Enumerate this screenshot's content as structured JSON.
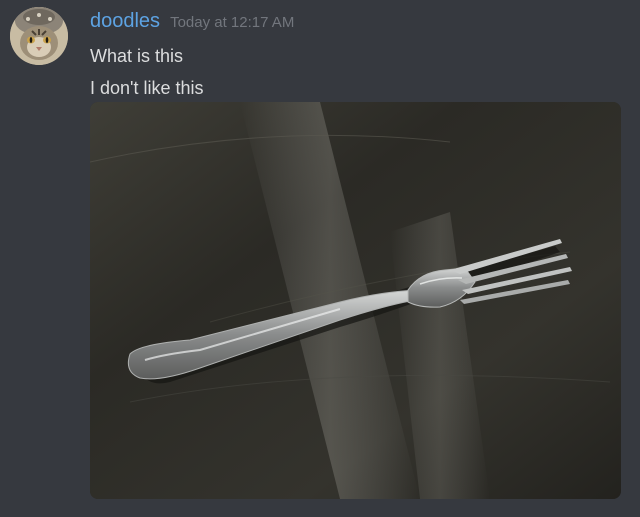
{
  "message": {
    "author": "doodles",
    "timestamp": "Today at 12:17 AM",
    "lines": [
      "What is this",
      "I don't like this"
    ],
    "colors": {
      "background": "#36393f",
      "username": "#5da3e3",
      "timestamp": "#72767d",
      "text": "#dcddde"
    }
  }
}
